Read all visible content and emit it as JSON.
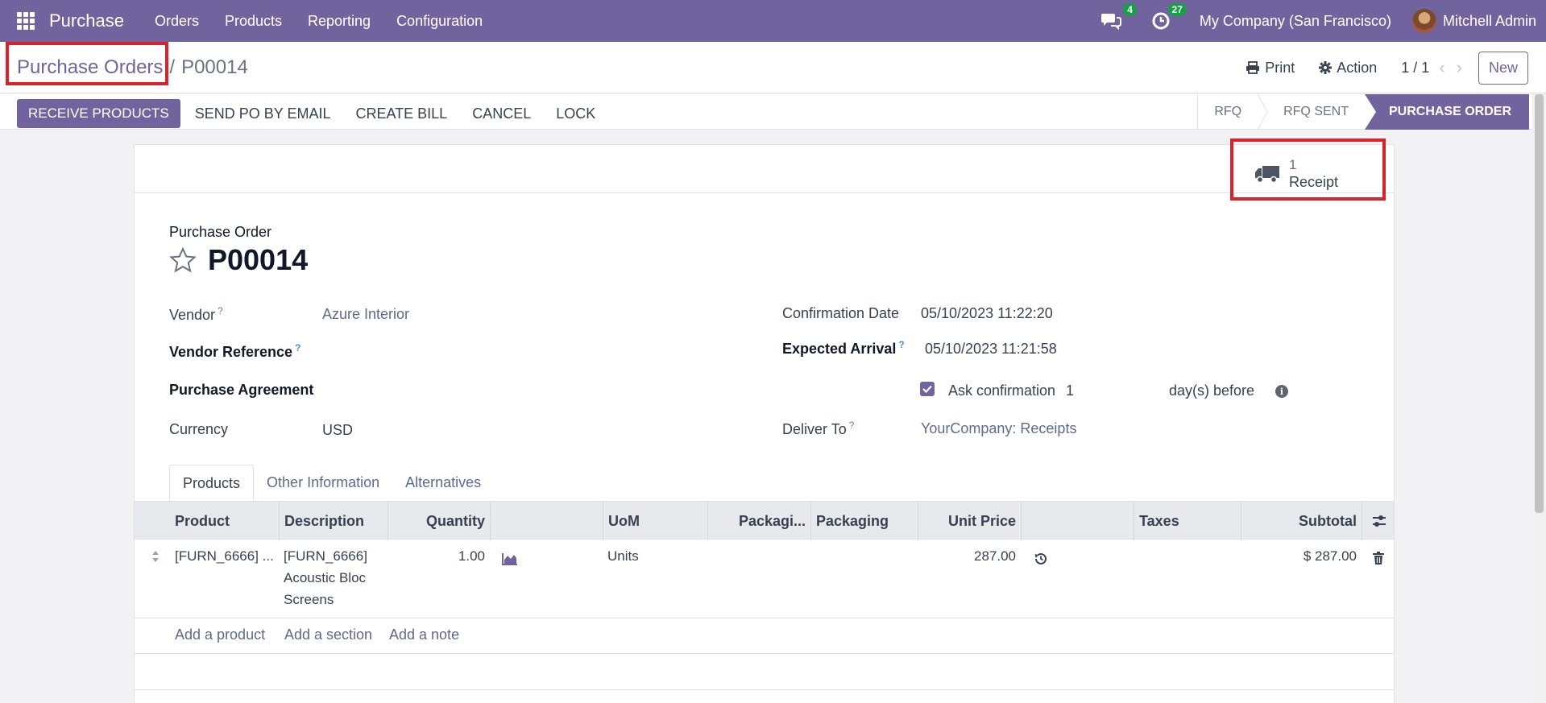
{
  "navbar": {
    "app_name": "Purchase",
    "menu": [
      "Orders",
      "Products",
      "Reporting",
      "Configuration"
    ],
    "messages_badge": "4",
    "activities_badge": "27",
    "company": "My Company (San Francisco)",
    "user": "Mitchell Admin"
  },
  "breadcrumb": {
    "parent": "Purchase Orders",
    "separator": "/",
    "current": "P00014"
  },
  "control": {
    "print": "Print",
    "action": "Action",
    "pager": "1 / 1",
    "new": "New"
  },
  "actions": {
    "receive": "RECEIVE PRODUCTS",
    "send": "SEND PO BY EMAIL",
    "bill": "CREATE BILL",
    "cancel": "CANCEL",
    "lock": "LOCK"
  },
  "stages": {
    "rfq": "RFQ",
    "rfq_sent": "RFQ SENT",
    "purchase_order": "PURCHASE ORDER"
  },
  "smart_button": {
    "value": "1",
    "label": "Receipt"
  },
  "form": {
    "title_label": "Purchase Order",
    "title": "P00014",
    "vendor_label": "Vendor",
    "vendor": "Azure Interior",
    "vendor_ref_label": "Vendor Reference",
    "agreement_label": "Purchase Agreement",
    "currency_label": "Currency",
    "currency": "USD",
    "confirmation_date_label": "Confirmation Date",
    "confirmation_date": "05/10/2023 11:22:20",
    "expected_arrival_label": "Expected Arrival",
    "expected_arrival": "05/10/2023 11:21:58",
    "ask_confirmation_label": "Ask confirmation",
    "ask_confirmation_days": "1",
    "days_before": "day(s) before",
    "deliver_to_label": "Deliver To",
    "deliver_to": "YourCompany: Receipts",
    "help_mark": "?"
  },
  "tabs": [
    "Products",
    "Other Information",
    "Alternatives"
  ],
  "table": {
    "headers": {
      "product": "Product",
      "description": "Description",
      "quantity": "Quantity",
      "uom": "UoM",
      "packaging_qty": "Packagi...",
      "packaging": "Packaging",
      "unit_price": "Unit Price",
      "taxes": "Taxes",
      "subtotal": "Subtotal"
    },
    "row": {
      "product": "[FURN_6666] ...",
      "description_1": "[FURN_6666]",
      "description_2": "Acoustic Bloc",
      "description_3": "Screens",
      "quantity": "1.00",
      "uom": "Units",
      "unit_price": "287.00",
      "subtotal": "$ 287.00"
    },
    "add_product": "Add a product",
    "add_section": "Add a section",
    "add_note": "Add a note"
  },
  "colors": {
    "brand": "#71639e",
    "highlight": "#d9222a",
    "badge": "#17a046"
  }
}
